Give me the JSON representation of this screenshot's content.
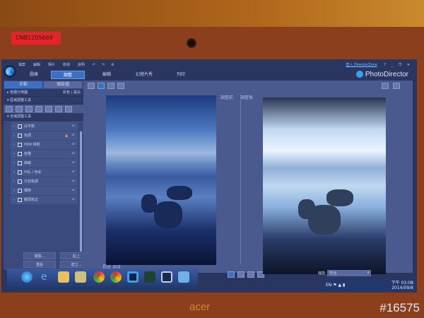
{
  "device": {
    "asset_label": "CNB1205669",
    "brand": "acer",
    "watermark": "#16575"
  },
  "menu": [
    "檔案",
    "編輯",
    "相片",
    "檢視",
    "說明"
  ],
  "window": {
    "login_link": "登入 DirectorZone",
    "help": "?",
    "minimize": "_",
    "restore": "❐",
    "close": "✕",
    "app_name": "PhotoDirector"
  },
  "tabs": [
    {
      "label": "圖庫"
    },
    {
      "label": "調整",
      "active": true
    },
    {
      "label": "編輯"
    },
    {
      "label": "幻燈片秀"
    },
    {
      "label": "列印"
    }
  ],
  "left_panel": {
    "tabs": [
      "手動",
      "預設檔"
    ],
    "histogram": {
      "label": "色階分佈圖",
      "color": "彩色",
      "bw": "黑白"
    },
    "regional": "區域調整工具",
    "global": "全域調整工具",
    "items": [
      "白平衡",
      "色調",
      "HDR 特效",
      "色階",
      "曲線",
      "HSL / 色彩",
      "分割色調",
      "細節",
      "鏡頭校正"
    ],
    "buttons": [
      "複製...",
      "貼上",
      "重設",
      "建立..."
    ]
  },
  "compare": {
    "before": "調整前",
    "after": "調整後"
  },
  "zoom": {
    "label": "縮放:",
    "value": "符合"
  },
  "tray": {
    "lang": "EN",
    "time": "下午 03:08",
    "date": "2014/09/8"
  }
}
